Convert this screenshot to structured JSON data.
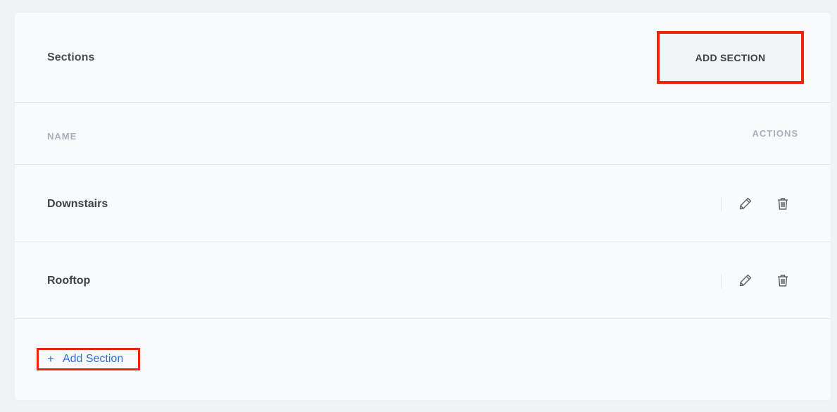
{
  "header": {
    "title": "Sections",
    "add_button_label": "ADD SECTION"
  },
  "table": {
    "columns": {
      "name": "NAME",
      "actions": "ACTIONS"
    },
    "rows": [
      {
        "name": "Downstairs"
      },
      {
        "name": "Rooftop"
      }
    ]
  },
  "footer": {
    "add_link_icon": "+",
    "add_link_label": "Add Section"
  },
  "icons": {
    "edit": "pencil-icon",
    "delete": "trash-icon"
  },
  "colors": {
    "highlight": "#f0230d",
    "link": "#2f6fd6"
  }
}
